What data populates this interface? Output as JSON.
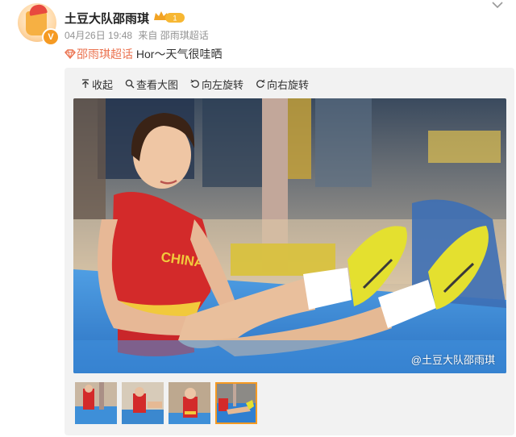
{
  "post": {
    "username": "土豆大队邵雨琪",
    "level_badge": "1",
    "date": "04月26日 19:48",
    "source": "来自 邵雨琪超话",
    "topic": "邵雨琪超话",
    "text": " Hor～天气很哇晒"
  },
  "toolbar": {
    "collapse_label": "收起",
    "view_large_label": "查看大图",
    "rotate_left_label": "向左旋转",
    "rotate_right_label": "向右旋转"
  },
  "image": {
    "watermark": "@土豆大队邵雨琪"
  },
  "thumbnails": [
    {
      "selected": false
    },
    {
      "selected": false
    },
    {
      "selected": false
    },
    {
      "selected": true
    }
  ],
  "colors": {
    "accent": "#f59a23",
    "topic": "#eb7350",
    "mat": "#2f7fd1",
    "jersey": "#d32a2a"
  }
}
